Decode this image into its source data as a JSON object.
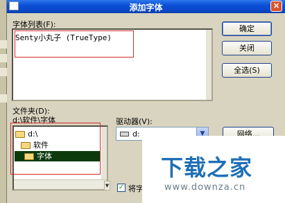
{
  "window": {
    "title": "添加字体",
    "close_glyph": "×"
  },
  "font_list": {
    "label": "字体列表(F):",
    "items": [
      "Senty小丸子 (TrueType)"
    ]
  },
  "buttons": {
    "ok": "确定",
    "close": "关闭",
    "select_all": "全选(S)",
    "network": "网络..."
  },
  "folders": {
    "label": "文件夹(D):",
    "path": "d:\\软件\\字体",
    "tree": [
      "d:\\",
      "软件",
      "字体"
    ],
    "selected": "字体"
  },
  "drives": {
    "label": "驱动器(V):",
    "value": "d:"
  },
  "copy_option": {
    "label": "将字",
    "checked": true
  },
  "watermark": {
    "brand": "下载之家",
    "url": "www.downza.cn"
  },
  "colors": {
    "titlebar": "#0b4fd6",
    "selection": "#0d3a0d",
    "highlight_frame": "#d22a2a",
    "watermark_brand": "#1f6fb8"
  }
}
